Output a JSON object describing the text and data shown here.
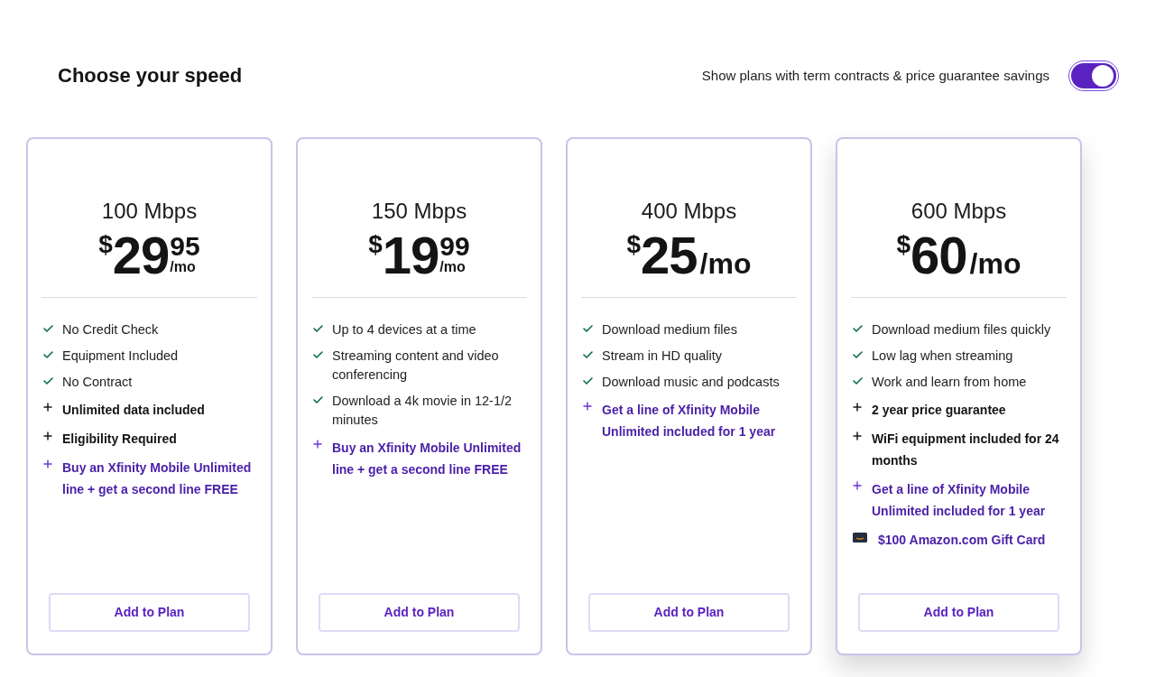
{
  "heading": "Choose your speed",
  "toggle": {
    "label": "Show plans with term contracts & price guarantee savings",
    "on": true
  },
  "plans": [
    {
      "speed": "100 Mbps",
      "price": {
        "currency": "$",
        "amount": "29",
        "cents": "95",
        "period": "/mo"
      },
      "highlighted": false,
      "features": [
        {
          "kind": "check",
          "text": "No Credit Check"
        },
        {
          "kind": "check",
          "text": "Equipment Included"
        },
        {
          "kind": "check",
          "text": "No Contract"
        },
        {
          "kind": "plus",
          "text": "Unlimited data included"
        },
        {
          "kind": "plus",
          "text": "Eligibility Required"
        },
        {
          "kind": "promo",
          "text": "Buy an Xfinity Mobile Unlimited line + get a second line FREE"
        }
      ],
      "button": "Add to Plan"
    },
    {
      "speed": "150 Mbps",
      "price": {
        "currency": "$",
        "amount": "19",
        "cents": "99",
        "period": "/mo"
      },
      "highlighted": false,
      "features": [
        {
          "kind": "check",
          "text": "Up to 4 devices at a time"
        },
        {
          "kind": "check",
          "text": "Streaming content and video conferencing"
        },
        {
          "kind": "check",
          "text": "Download a 4k movie in 12-1/2 minutes"
        },
        {
          "kind": "promo",
          "text": "Buy an Xfinity Mobile Unlimited line + get a second line FREE"
        }
      ],
      "button": "Add to Plan"
    },
    {
      "speed": "400 Mbps",
      "price": {
        "currency": "$",
        "amount": "25",
        "period": "/mo"
      },
      "highlighted": false,
      "features": [
        {
          "kind": "check",
          "text": "Download medium files"
        },
        {
          "kind": "check",
          "text": "Stream in HD quality"
        },
        {
          "kind": "check",
          "text": "Download music and podcasts"
        },
        {
          "kind": "promo",
          "text": "Get a line of Xfinity Mobile Unlimited included for 1 year"
        }
      ],
      "button": "Add to Plan"
    },
    {
      "speed": "600 Mbps",
      "price": {
        "currency": "$",
        "amount": "60",
        "period": "/mo"
      },
      "highlighted": true,
      "features": [
        {
          "kind": "check",
          "text": "Download medium files quickly"
        },
        {
          "kind": "check",
          "text": "Low lag when streaming"
        },
        {
          "kind": "check",
          "text": "Work and learn from home"
        },
        {
          "kind": "plus",
          "text": "2 year price guarantee"
        },
        {
          "kind": "plus",
          "text": "WiFi equipment included for 24 months"
        },
        {
          "kind": "promo",
          "text": "Get a line of Xfinity Mobile Unlimited included for 1 year"
        },
        {
          "kind": "gift",
          "text": "$100 Amazon.com Gift Card"
        }
      ],
      "button": "Add to Plan"
    }
  ]
}
